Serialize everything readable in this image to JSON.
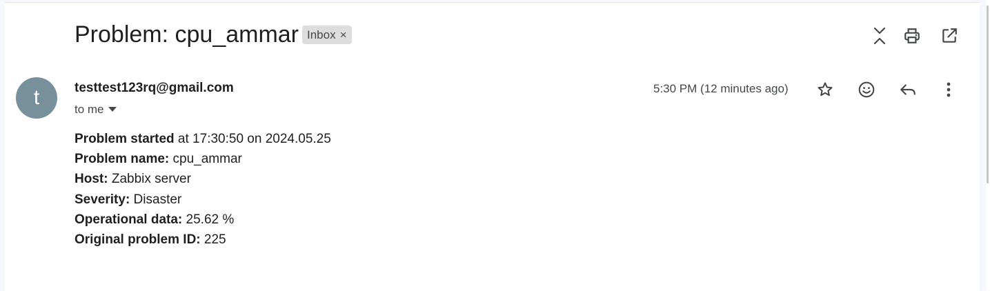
{
  "email": {
    "subject": "Problem: cpu_ammar",
    "label_chip": "Inbox",
    "label_remove": "×",
    "sender_initial": "t",
    "sender_email": "testtest123rq@gmail.com",
    "recipient": "to me",
    "time": "5:30 PM (12 minutes ago)"
  },
  "toolbar": {
    "icons": [
      "collapse-all-icon",
      "print-icon",
      "open-in-new-window-icon"
    ]
  },
  "message_actions": {
    "icons": [
      "star-icon",
      "emoji-icon",
      "reply-icon",
      "more-vert-icon"
    ]
  },
  "body": {
    "line1_label": "Problem started",
    "line1_value": " at 17:30:50 on 2024.05.25",
    "line2_label": "Problem name:",
    "line2_value": " cpu_ammar",
    "line3_label": "Host:",
    "line3_value": " Zabbix server",
    "line4_label": "Severity:",
    "line4_value": " Disaster",
    "line5_label": "Operational data:",
    "line5_value": " 25.62 %",
    "line6_label": "Original problem ID:",
    "line6_value": " 225"
  },
  "colors": {
    "avatar_bg": "#78909c",
    "chip_bg": "#dddddd",
    "text_primary": "#1f1f1f",
    "text_secondary": "#444746"
  }
}
